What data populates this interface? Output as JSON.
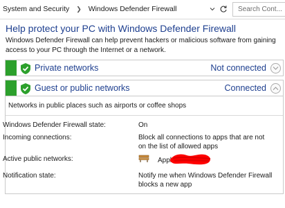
{
  "address_bar": {
    "breadcrumbs": [
      "System and Security",
      "Windows Defender Firewall"
    ],
    "search_placeholder": "Search Cont..."
  },
  "page": {
    "title": "Help protect your PC with Windows Defender Firewall",
    "description": "Windows Defender Firewall can help prevent hackers or malicious software from gaining access to your PC through the Internet or a network."
  },
  "private_networks": {
    "label": "Private networks",
    "status": "Not connected",
    "expanded": false
  },
  "public_networks": {
    "label": "Guest or public networks",
    "status": "Connected",
    "expanded": true,
    "description": "Networks in public places such as airports or coffee shops",
    "details": [
      {
        "label": "Windows Defender Firewall state:",
        "value": "On"
      },
      {
        "label": "Incoming connections:",
        "value": "Block all connections to apps that are not on the list of allowed apps"
      },
      {
        "label": "Active public networks:",
        "value": "Apple"
      },
      {
        "label": "Notification state:",
        "value": "Notify me when Windows Defender Firewall blocks a new app"
      }
    ]
  },
  "colors": {
    "accent_green": "#2ca02c",
    "link_blue": "#1e3f8f",
    "redaction_red": "#ff0000"
  }
}
